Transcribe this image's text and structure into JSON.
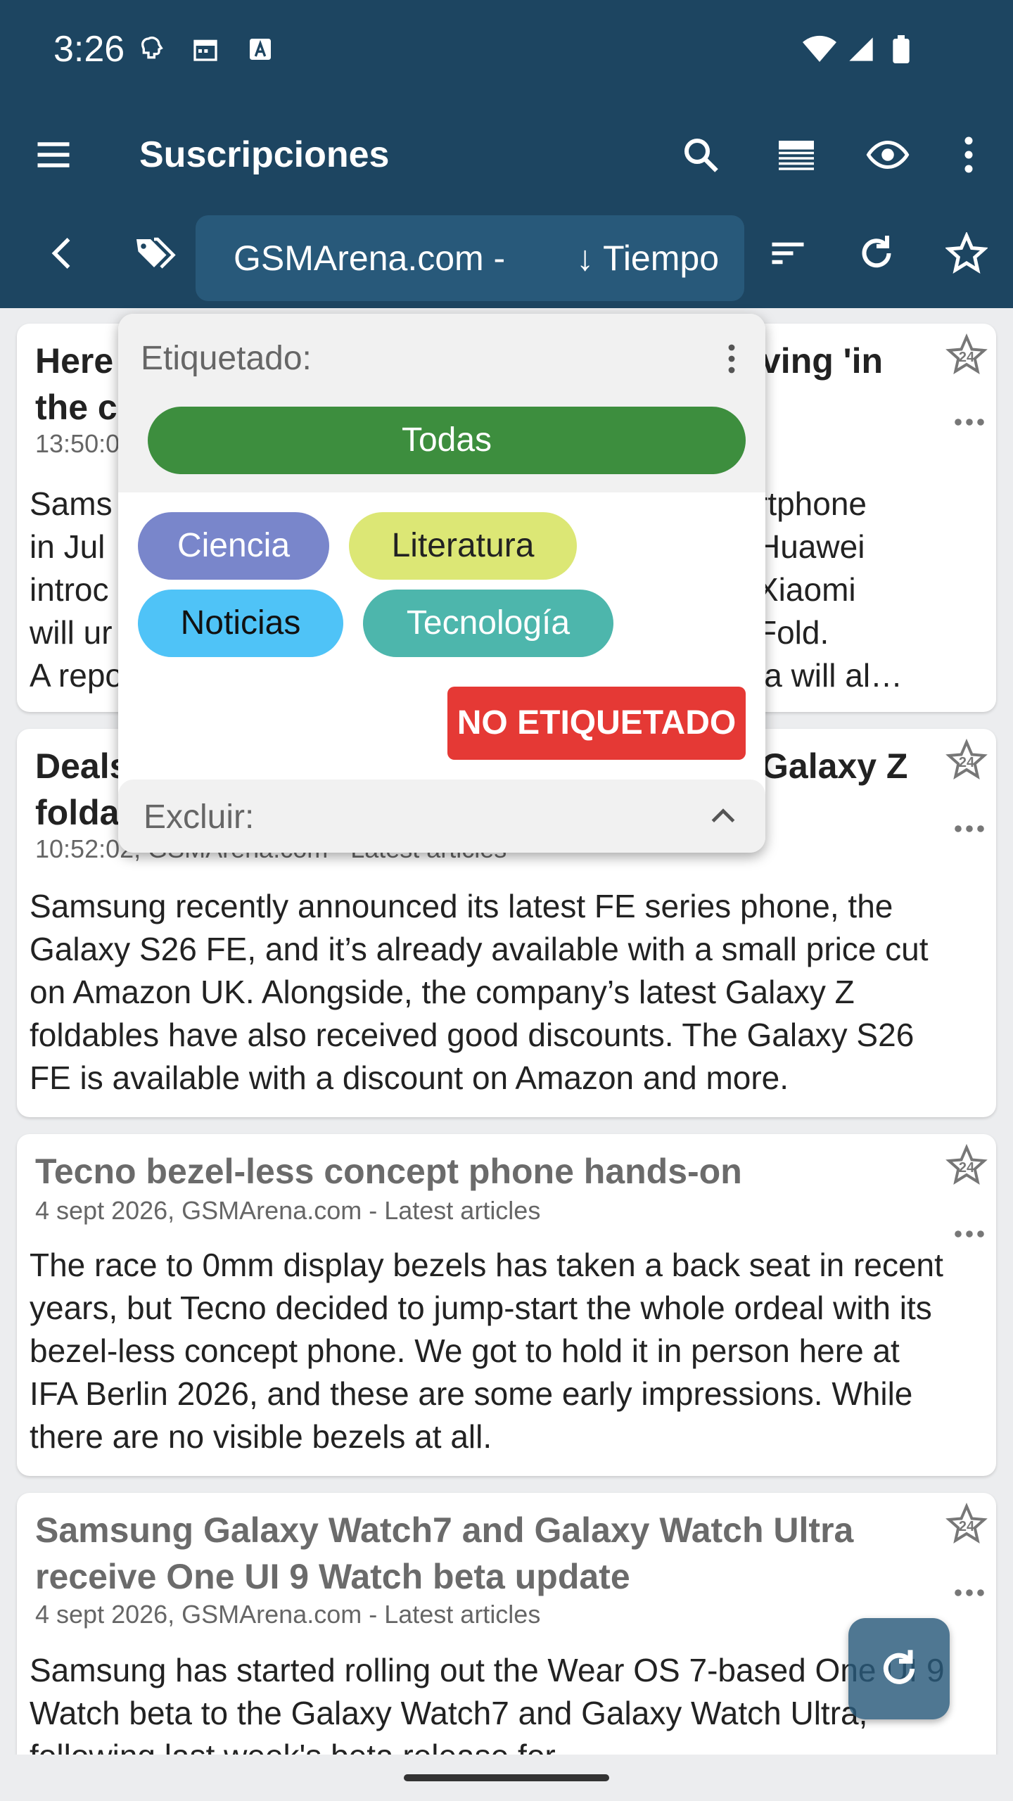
{
  "status": {
    "time": "3:26"
  },
  "toolbar": {
    "title": "Suscripciones"
  },
  "filterbar": {
    "source": "GSMArena.com -",
    "sort": "↓ Tiempo"
  },
  "articles": [
    {
      "title": "Here ... ving 'in the c",
      "title_left": "Here",
      "title_right": "ving 'in",
      "title_line2": "the c",
      "meta": "13:50:0",
      "body_left": [
        "Sams",
        "in Jul",
        "introc",
        "will ur",
        "A repo"
      ],
      "body_right": [
        "rtphone",
        "Huawei",
        "Xiaomi",
        "Fold.",
        "la will al…"
      ]
    },
    {
      "title_left": "Deals",
      "title_right": "Galaxy Z",
      "title_line2": "folda",
      "meta": "10:52:02, GSMArena.com - Latest articles",
      "body": "Samsung recently announced its latest FE series phone, the Galaxy S26 FE, and it’s already available with a small price cut on Amazon UK. Alongside, the company’s latest Galaxy Z foldables have also received good discounts. The Galaxy S26 FE is available with a discount on Amazon and more."
    },
    {
      "title": "Tecno bezel-less concept phone hands-on",
      "meta": "4 sept 2026, GSMArena.com - Latest articles",
      "body": "The race to 0mm display bezels has taken a back seat in recent years, but Tecno decided to jump-start the whole ordeal with its bezel-less concept phone. We got to hold it in person here at IFA Berlin 2026, and these are some early impressions. While there are no visible bezels at all."
    },
    {
      "title": "Samsung Galaxy Watch7 and Galaxy Watch Ultra receive One UI 9 Watch beta update",
      "meta": "4 sept 2026, GSMArena.com - Latest articles",
      "body": "Samsung has started rolling out the Wear OS 7-based One UI 9 Watch beta to the Galaxy Watch7 and Galaxy Watch Ultra, following last week's beta release for"
    }
  ],
  "popup": {
    "label": "Etiquetado:",
    "all": "Todas",
    "tags": [
      {
        "label": "Ciencia",
        "color": "#7986cb",
        "text_color": "#ffffff"
      },
      {
        "label": "Literatura",
        "color": "#dce775",
        "text_color": "#222222"
      },
      {
        "label": "Noticias",
        "color": "#4fc3f7",
        "text_color": "#111111"
      },
      {
        "label": "Tecnología",
        "color": "#4db6ac",
        "text_color": "#ffffff"
      }
    ],
    "untagged": "NO ETIQUETADO",
    "exclude": "Excluir:"
  },
  "colors": {
    "bar": "#1d4561",
    "chip": "#28597a",
    "todas": "#3d8e3e",
    "untagged": "#e53935"
  }
}
